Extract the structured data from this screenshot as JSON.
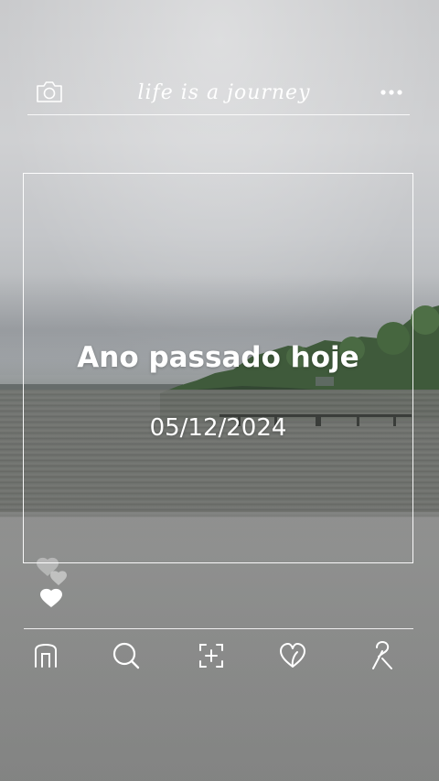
{
  "header": {
    "title": "life is a journey",
    "camera_icon": "camera-icon",
    "more_icon": "more-horizontal-icon"
  },
  "card": {
    "headline": "Ano passado hoje",
    "date": "05/12/2024"
  },
  "reactions": {
    "icon": "hearts-icon"
  },
  "nav": {
    "items": [
      {
        "name": "home",
        "icon": "home-icon"
      },
      {
        "name": "search",
        "icon": "search-icon"
      },
      {
        "name": "add",
        "icon": "add-post-icon"
      },
      {
        "name": "likes",
        "icon": "heart-icon"
      },
      {
        "name": "profile",
        "icon": "profile-icon"
      }
    ]
  },
  "colors": {
    "line": "#ffffff",
    "text": "#ffffff",
    "sky": "#cfd0d2",
    "water": "#6c6e6b",
    "trees": "#3e5a3a"
  }
}
